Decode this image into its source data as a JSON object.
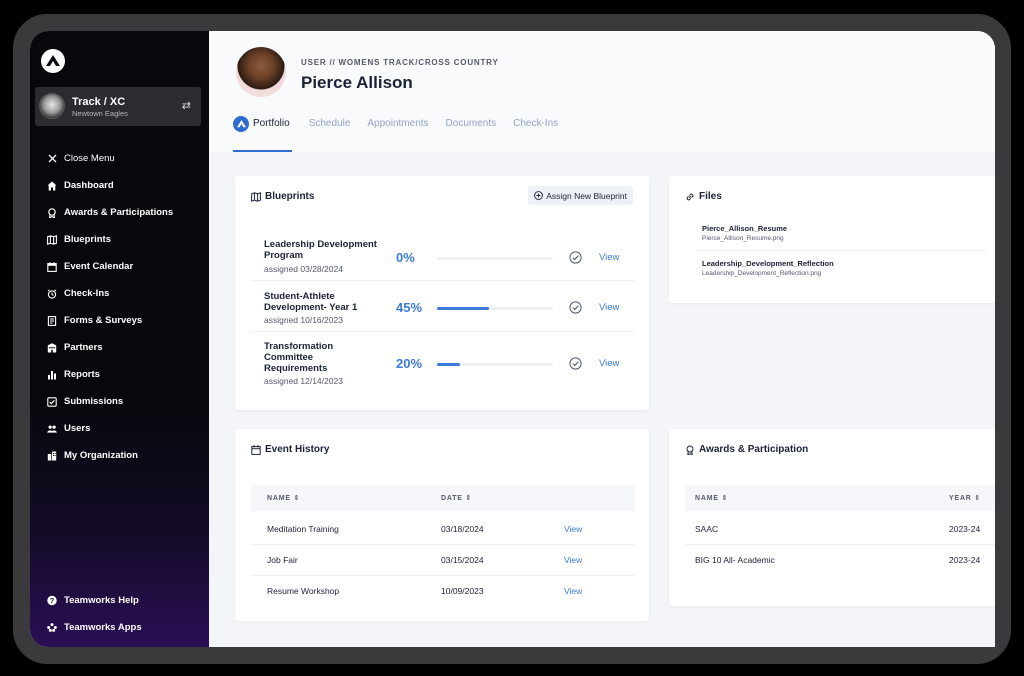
{
  "colors": {
    "accent": "#3b7bd8",
    "brand": "#2f6bd1",
    "sidebar_bg": "#08080c"
  },
  "sidebar": {
    "team": {
      "name": "Track / XC",
      "subtitle": "Newtown Eagles"
    },
    "items": [
      {
        "label": "Close Menu",
        "icon": "close-icon"
      },
      {
        "label": "Dashboard",
        "icon": "home-icon"
      },
      {
        "label": "Awards & Participations",
        "icon": "award-icon"
      },
      {
        "label": "Blueprints",
        "icon": "map-icon"
      },
      {
        "label": "Event Calendar",
        "icon": "calendar-icon"
      },
      {
        "label": "Check-Ins",
        "icon": "alarm-icon"
      },
      {
        "label": "Forms & Surveys",
        "icon": "form-icon"
      },
      {
        "label": "Partners",
        "icon": "building-icon"
      },
      {
        "label": "Reports",
        "icon": "chart-icon"
      },
      {
        "label": "Submissions",
        "icon": "check-square-icon"
      },
      {
        "label": "Users",
        "icon": "users-icon"
      },
      {
        "label": "My Organization",
        "icon": "organization-icon"
      }
    ],
    "bottom": [
      {
        "label": "Teamworks Help",
        "icon": "help-icon"
      },
      {
        "label": "Teamworks Apps",
        "icon": "apps-icon"
      }
    ]
  },
  "header": {
    "breadcrumb": "USER // WOMENS TRACK/CROSS COUNTRY",
    "title": "Pierce Allison",
    "tabs": [
      "Portfolio",
      "Schedule",
      "Appointments",
      "Documents",
      "Check-Ins"
    ]
  },
  "blueprints": {
    "title": "Blueprints",
    "assign_label": "Assign New Blueprint",
    "view_label": "View",
    "rows": [
      {
        "name": "Leadership Development Program",
        "date": "assigned 03/28/2024",
        "pct": "0%",
        "progress": 0
      },
      {
        "name": "Student-Athlete Development- Year 1",
        "date": "assigned 10/16/2023",
        "pct": "45%",
        "progress": 0.45
      },
      {
        "name": "Transformation Committee Requirements",
        "date": "assigned 12/14/2023",
        "pct": "20%",
        "progress": 0.2
      }
    ]
  },
  "files": {
    "title": "Files",
    "items": [
      {
        "name": "Pierce_Allison_Resume",
        "file": "Pierce_Allison_Resume.png"
      },
      {
        "name": "Leadership_Development_Reflection",
        "file": "Leadership_Development_Reflection.png"
      }
    ]
  },
  "events": {
    "title": "Event History",
    "col_name": "NAME",
    "col_date": "DATE",
    "view_label": "View",
    "rows": [
      {
        "name": "Meditation Training",
        "date": "03/18/2024"
      },
      {
        "name": "Job Fair",
        "date": "03/15/2024"
      },
      {
        "name": "Resume Workshop",
        "date": "10/09/2023"
      }
    ]
  },
  "awards": {
    "title": "Awards & Participation",
    "col_name": "NAME",
    "col_year": "YEAR",
    "rows": [
      {
        "name": "SAAC",
        "year": "2023-24"
      },
      {
        "name": "BIG 10 All- Academic",
        "year": "2023-24"
      }
    ]
  }
}
